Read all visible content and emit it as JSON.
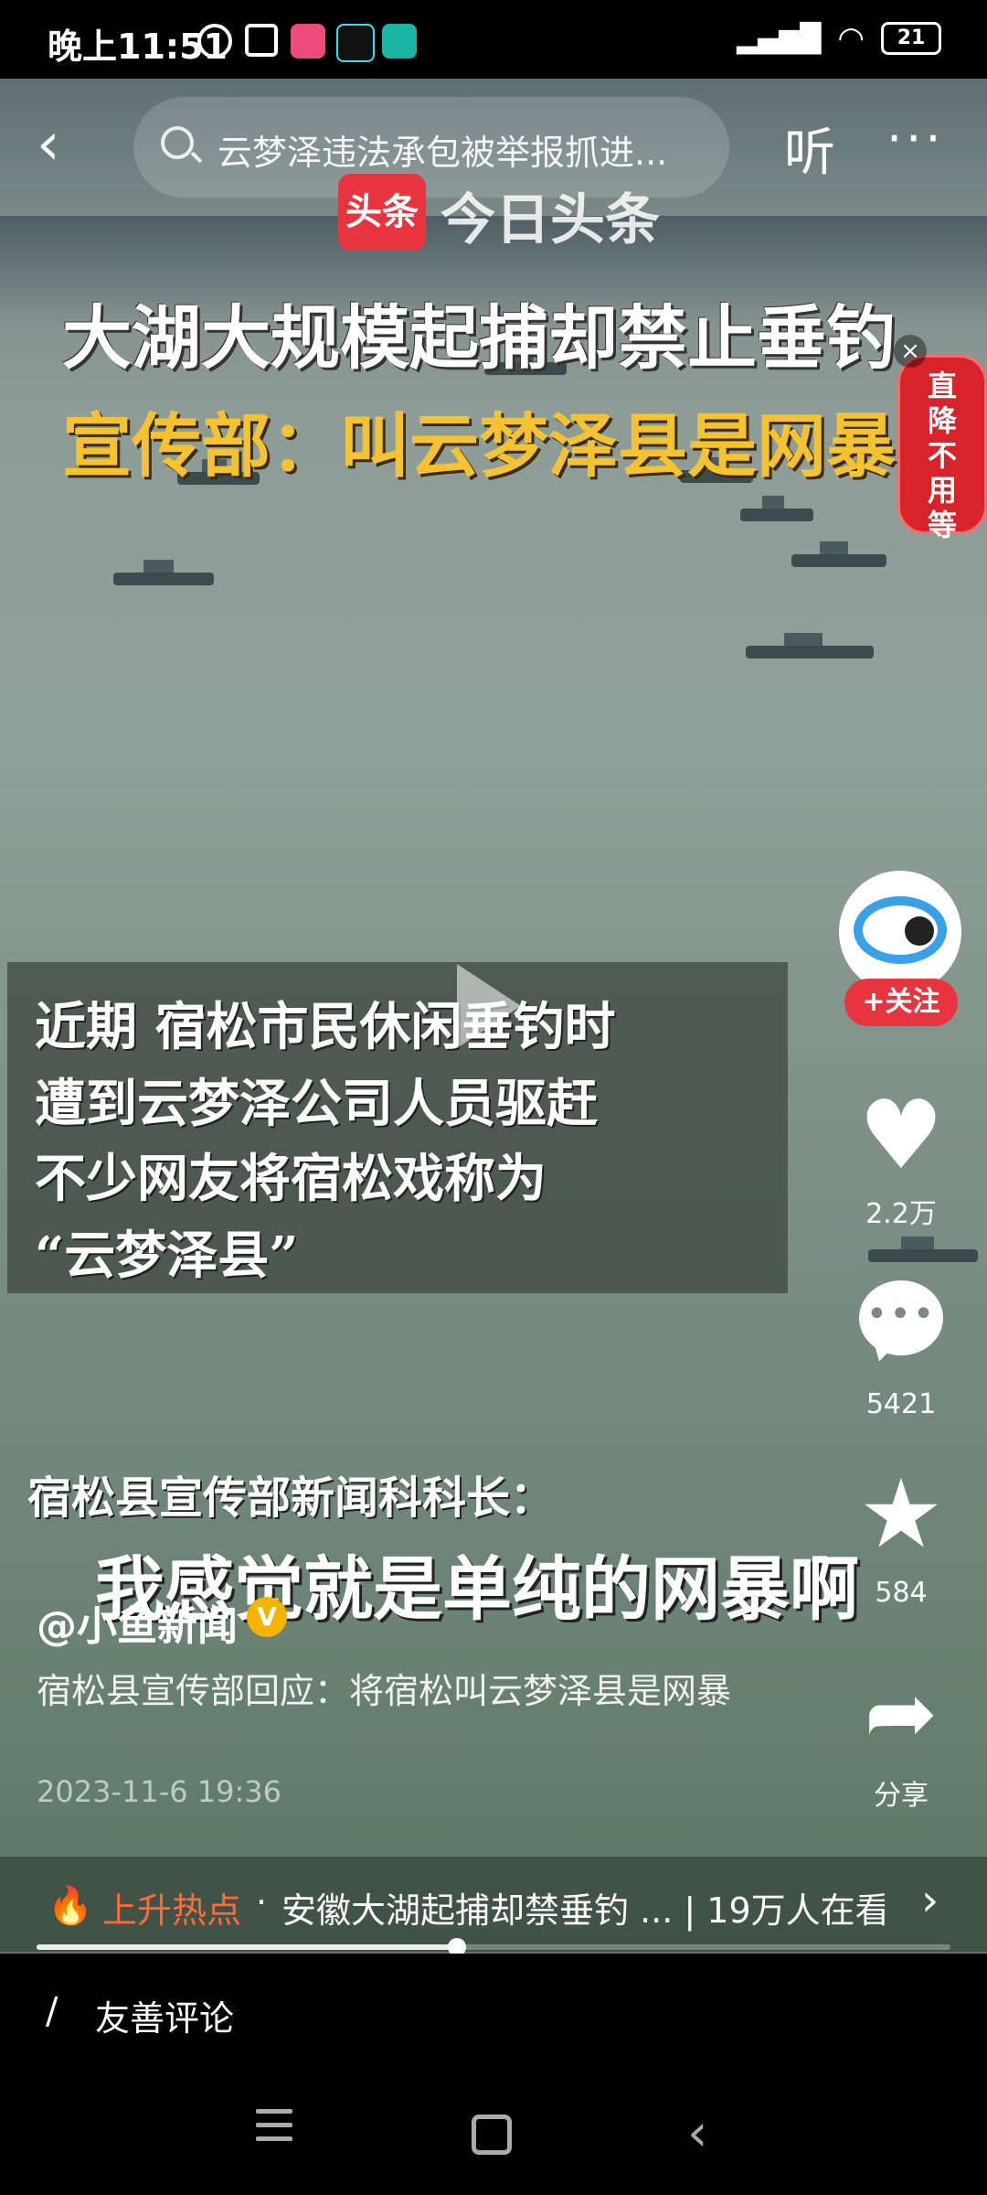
{
  "status_bar": {
    "time": "晚上11:51",
    "battery": "21"
  },
  "nav": {
    "search_text": "云梦泽违法承包被举报抓进...",
    "listen_label": "听",
    "more_label": "···"
  },
  "video": {
    "logo_badge": "头条",
    "logo_name": "今日头条",
    "headline_line1": "大湖大规模起捕却禁止垂钓",
    "headline_line2": "宣传部：叫云梦泽县是网暴",
    "subtitle_lines": [
      "近期  宿松市民休闲垂钓时",
      "遭到云梦泽公司人员驱赶",
      "不少网友将宿松戏称为",
      " “云梦泽县”"
    ],
    "caption_small": "宿松县宣传部新闻科科长：",
    "caption_big": "我感觉就是单纯的网暴啊",
    "ad_text": "直降不用等"
  },
  "actions": {
    "follow_label": "+关注",
    "likes": "2.2万",
    "comments": "5421",
    "favorites": "584",
    "share_label": "分享"
  },
  "post": {
    "author": "@小鱼新闻",
    "description": "宿松县宣传部回应：将宿松叫云梦泽县是网暴",
    "datetime": "2023-11-6 19:36"
  },
  "hot": {
    "label": "上升热点",
    "separator": "·",
    "text": "安徽大湖起捕却禁垂钓 ... | 19万人在看"
  },
  "progress": 0.46,
  "comment_bar": {
    "placeholder": "友善评论"
  }
}
